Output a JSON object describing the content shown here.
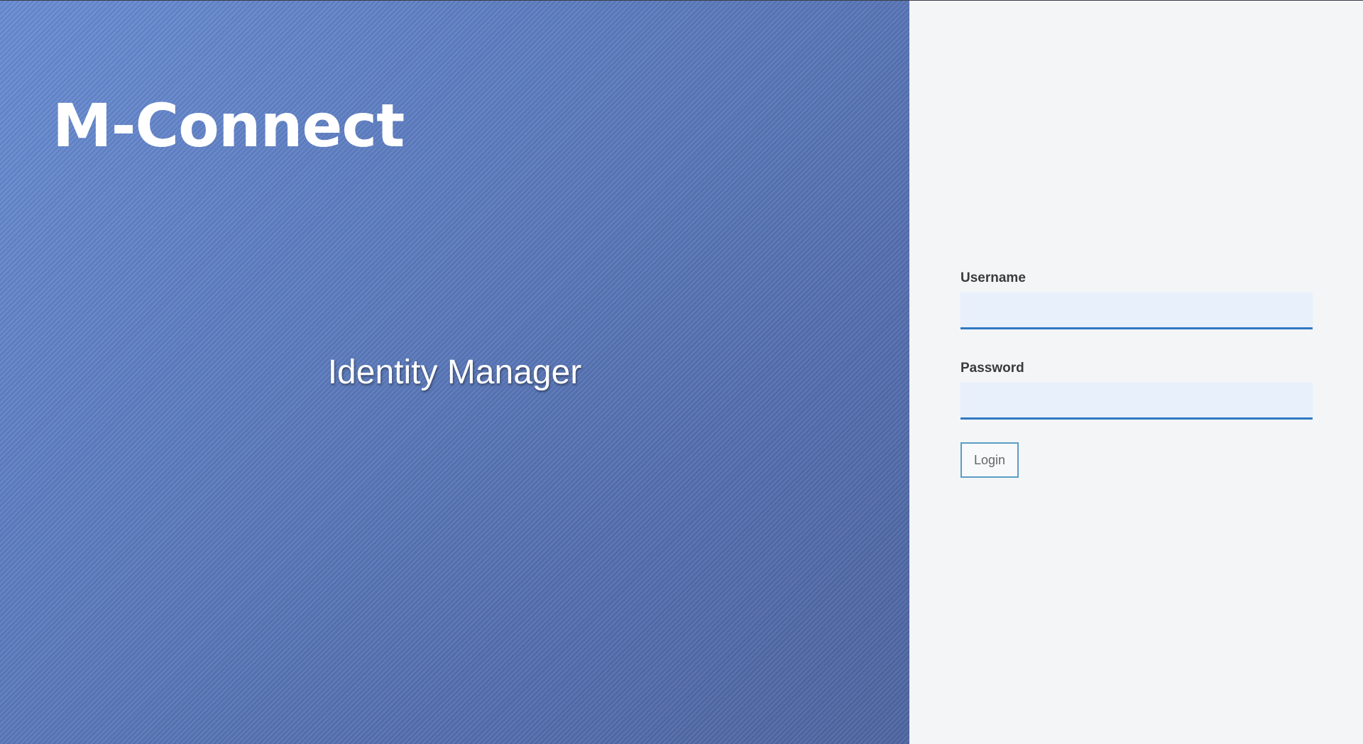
{
  "hero": {
    "brand": "M-Connect",
    "subtitle": "Identity Manager"
  },
  "login_form": {
    "username_label": "Username",
    "username_value": "",
    "password_label": "Password",
    "password_value": "",
    "login_label": "Login"
  },
  "colors": {
    "hero_gradient_start": "#6b8fd6",
    "hero_gradient_end": "#5068a4",
    "panel_background": "#f3f5f7",
    "input_background": "#e8f0fc",
    "input_underline": "#2f79c2",
    "button_border": "#5b9ec4"
  }
}
